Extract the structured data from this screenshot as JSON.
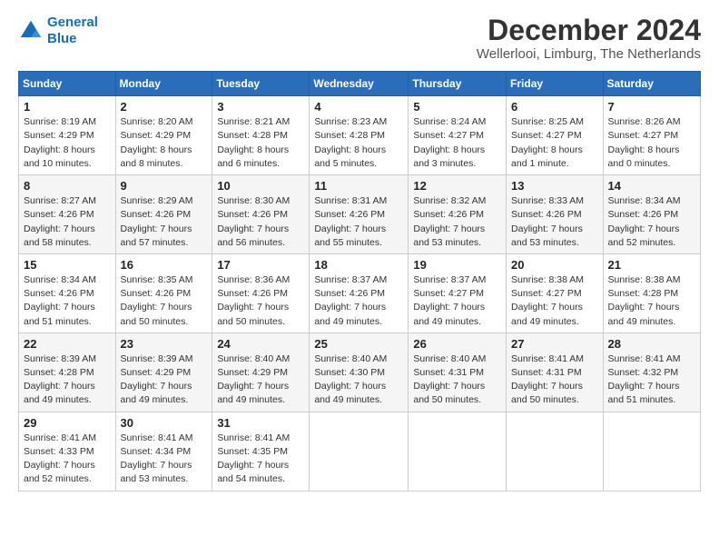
{
  "logo": {
    "line1": "General",
    "line2": "Blue"
  },
  "title": "December 2024",
  "subtitle": "Wellerlooi, Limburg, The Netherlands",
  "days_of_week": [
    "Sunday",
    "Monday",
    "Tuesday",
    "Wednesday",
    "Thursday",
    "Friday",
    "Saturday"
  ],
  "weeks": [
    [
      {
        "day": "1",
        "detail": "Sunrise: 8:19 AM\nSunset: 4:29 PM\nDaylight: 8 hours\nand 10 minutes."
      },
      {
        "day": "2",
        "detail": "Sunrise: 8:20 AM\nSunset: 4:29 PM\nDaylight: 8 hours\nand 8 minutes."
      },
      {
        "day": "3",
        "detail": "Sunrise: 8:21 AM\nSunset: 4:28 PM\nDaylight: 8 hours\nand 6 minutes."
      },
      {
        "day": "4",
        "detail": "Sunrise: 8:23 AM\nSunset: 4:28 PM\nDaylight: 8 hours\nand 5 minutes."
      },
      {
        "day": "5",
        "detail": "Sunrise: 8:24 AM\nSunset: 4:27 PM\nDaylight: 8 hours\nand 3 minutes."
      },
      {
        "day": "6",
        "detail": "Sunrise: 8:25 AM\nSunset: 4:27 PM\nDaylight: 8 hours\nand 1 minute."
      },
      {
        "day": "7",
        "detail": "Sunrise: 8:26 AM\nSunset: 4:27 PM\nDaylight: 8 hours\nand 0 minutes."
      }
    ],
    [
      {
        "day": "8",
        "detail": "Sunrise: 8:27 AM\nSunset: 4:26 PM\nDaylight: 7 hours\nand 58 minutes."
      },
      {
        "day": "9",
        "detail": "Sunrise: 8:29 AM\nSunset: 4:26 PM\nDaylight: 7 hours\nand 57 minutes."
      },
      {
        "day": "10",
        "detail": "Sunrise: 8:30 AM\nSunset: 4:26 PM\nDaylight: 7 hours\nand 56 minutes."
      },
      {
        "day": "11",
        "detail": "Sunrise: 8:31 AM\nSunset: 4:26 PM\nDaylight: 7 hours\nand 55 minutes."
      },
      {
        "day": "12",
        "detail": "Sunrise: 8:32 AM\nSunset: 4:26 PM\nDaylight: 7 hours\nand 53 minutes."
      },
      {
        "day": "13",
        "detail": "Sunrise: 8:33 AM\nSunset: 4:26 PM\nDaylight: 7 hours\nand 53 minutes."
      },
      {
        "day": "14",
        "detail": "Sunrise: 8:34 AM\nSunset: 4:26 PM\nDaylight: 7 hours\nand 52 minutes."
      }
    ],
    [
      {
        "day": "15",
        "detail": "Sunrise: 8:34 AM\nSunset: 4:26 PM\nDaylight: 7 hours\nand 51 minutes."
      },
      {
        "day": "16",
        "detail": "Sunrise: 8:35 AM\nSunset: 4:26 PM\nDaylight: 7 hours\nand 50 minutes."
      },
      {
        "day": "17",
        "detail": "Sunrise: 8:36 AM\nSunset: 4:26 PM\nDaylight: 7 hours\nand 50 minutes."
      },
      {
        "day": "18",
        "detail": "Sunrise: 8:37 AM\nSunset: 4:26 PM\nDaylight: 7 hours\nand 49 minutes."
      },
      {
        "day": "19",
        "detail": "Sunrise: 8:37 AM\nSunset: 4:27 PM\nDaylight: 7 hours\nand 49 minutes."
      },
      {
        "day": "20",
        "detail": "Sunrise: 8:38 AM\nSunset: 4:27 PM\nDaylight: 7 hours\nand 49 minutes."
      },
      {
        "day": "21",
        "detail": "Sunrise: 8:38 AM\nSunset: 4:28 PM\nDaylight: 7 hours\nand 49 minutes."
      }
    ],
    [
      {
        "day": "22",
        "detail": "Sunrise: 8:39 AM\nSunset: 4:28 PM\nDaylight: 7 hours\nand 49 minutes."
      },
      {
        "day": "23",
        "detail": "Sunrise: 8:39 AM\nSunset: 4:29 PM\nDaylight: 7 hours\nand 49 minutes."
      },
      {
        "day": "24",
        "detail": "Sunrise: 8:40 AM\nSunset: 4:29 PM\nDaylight: 7 hours\nand 49 minutes."
      },
      {
        "day": "25",
        "detail": "Sunrise: 8:40 AM\nSunset: 4:30 PM\nDaylight: 7 hours\nand 49 minutes."
      },
      {
        "day": "26",
        "detail": "Sunrise: 8:40 AM\nSunset: 4:31 PM\nDaylight: 7 hours\nand 50 minutes."
      },
      {
        "day": "27",
        "detail": "Sunrise: 8:41 AM\nSunset: 4:31 PM\nDaylight: 7 hours\nand 50 minutes."
      },
      {
        "day": "28",
        "detail": "Sunrise: 8:41 AM\nSunset: 4:32 PM\nDaylight: 7 hours\nand 51 minutes."
      }
    ],
    [
      {
        "day": "29",
        "detail": "Sunrise: 8:41 AM\nSunset: 4:33 PM\nDaylight: 7 hours\nand 52 minutes."
      },
      {
        "day": "30",
        "detail": "Sunrise: 8:41 AM\nSunset: 4:34 PM\nDaylight: 7 hours\nand 53 minutes."
      },
      {
        "day": "31",
        "detail": "Sunrise: 8:41 AM\nSunset: 4:35 PM\nDaylight: 7 hours\nand 54 minutes."
      },
      {
        "day": "",
        "detail": ""
      },
      {
        "day": "",
        "detail": ""
      },
      {
        "day": "",
        "detail": ""
      },
      {
        "day": "",
        "detail": ""
      }
    ]
  ]
}
